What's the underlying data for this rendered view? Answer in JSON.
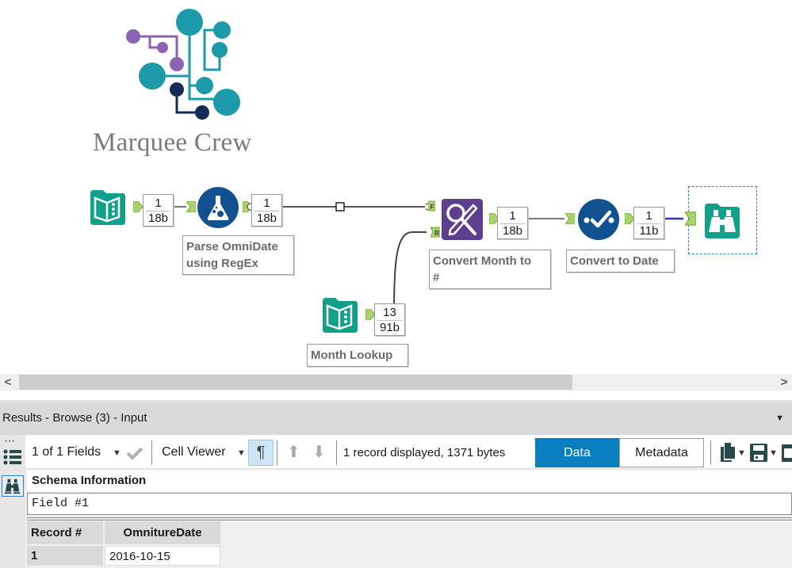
{
  "logo": {
    "name": "Marquee Crew",
    "colors": {
      "purple": "#8c63b0",
      "teal": "#1d9aa9",
      "navy": "#152a55"
    }
  },
  "workflow": {
    "tools": [
      {
        "id": "input-data-1",
        "type": "input-data",
        "icon": "book-icon",
        "color": "#12a08a"
      },
      {
        "id": "regex",
        "type": "regex",
        "icon": "flask-icon",
        "color": "#11518f",
        "caption_lines": [
          "Parse OmniDate",
          "using RegEx"
        ]
      },
      {
        "id": "find-replace",
        "type": "find-replace",
        "icon": "magnify-pencil-icon",
        "color": "#5d3e8f",
        "caption_lines": [
          "Convert Month to",
          "#"
        ],
        "inputs": [
          "F",
          "R"
        ]
      },
      {
        "id": "datetime",
        "type": "datetime",
        "icon": "check-dots-icon",
        "color": "#11518f",
        "caption_lines": [
          "Convert to Date"
        ]
      },
      {
        "id": "browse",
        "type": "browse",
        "icon": "binoculars-icon",
        "color": "#12a08a"
      },
      {
        "id": "month-lookup",
        "type": "input-data",
        "icon": "book-icon",
        "color": "#12a08a",
        "caption_lines": [
          "Month Lookup"
        ]
      }
    ],
    "badges": [
      {
        "records": "1",
        "size": "18b"
      },
      {
        "records": "1",
        "size": "18b"
      },
      {
        "records": "1",
        "size": "18b"
      },
      {
        "records": "1",
        "size": "11b"
      },
      {
        "records": "13",
        "size": "91b"
      }
    ]
  },
  "scrollbar": {
    "left_arrow": "<",
    "right_arrow": ">"
  },
  "results": {
    "title": "Results - Browse (3) - Input",
    "dropdown_glyph": "▼",
    "toolbar": {
      "fields_label": "1 of 1 Fields",
      "cell_viewer_label": "Cell Viewer",
      "pilcrow": "¶",
      "up_arrow": "⬆",
      "down_arrow": "⬇",
      "status": "1 record displayed, 1371 bytes",
      "data_tab": "Data",
      "metadata_tab": "Metadata",
      "dropdown_glyph": "▼"
    },
    "schema_title": "Schema Information",
    "field_name": "Field #1",
    "table": {
      "columns": [
        "Record #",
        "OmnitureDate"
      ],
      "rows": [
        [
          "1",
          "2016-10-15"
        ]
      ]
    },
    "accent": "#0a7fbf"
  }
}
